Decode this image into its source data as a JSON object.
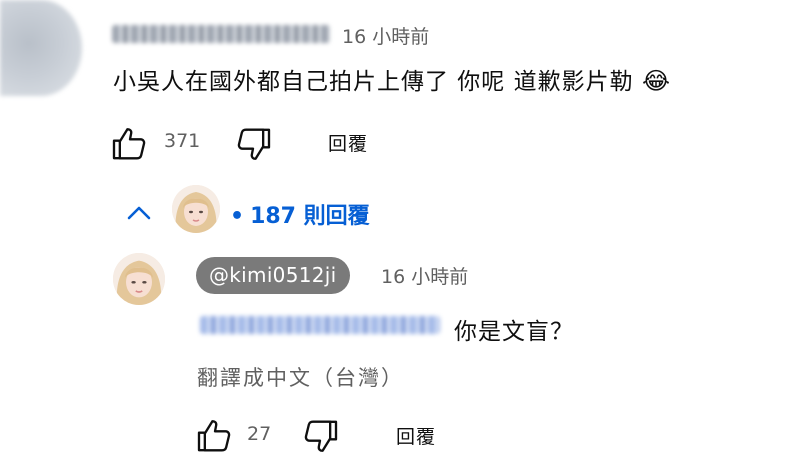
{
  "comment": {
    "time": "16 小時前",
    "text": "小吳人在國外都自己拍片上傳了 你呢 道歉影片勒",
    "emoji": "😂",
    "like_count": "371",
    "reply_label": "回覆"
  },
  "replies_toggle": {
    "bullet": "•",
    "count_label": "187 則回覆"
  },
  "reply": {
    "handle": "@kimi0512ji",
    "time": "16 小時前",
    "text": "你是文盲？",
    "translate_label": "翻譯成中文（台灣）",
    "like_count": "27",
    "reply_label": "回覆"
  },
  "colors": {
    "link_blue": "#065fd4",
    "muted_text": "#606060",
    "handle_pill": "#7a7a7a"
  },
  "icons": {
    "like": "thumbs-up-outline",
    "dislike": "thumbs-down-outline",
    "collapse": "chevron-up"
  }
}
